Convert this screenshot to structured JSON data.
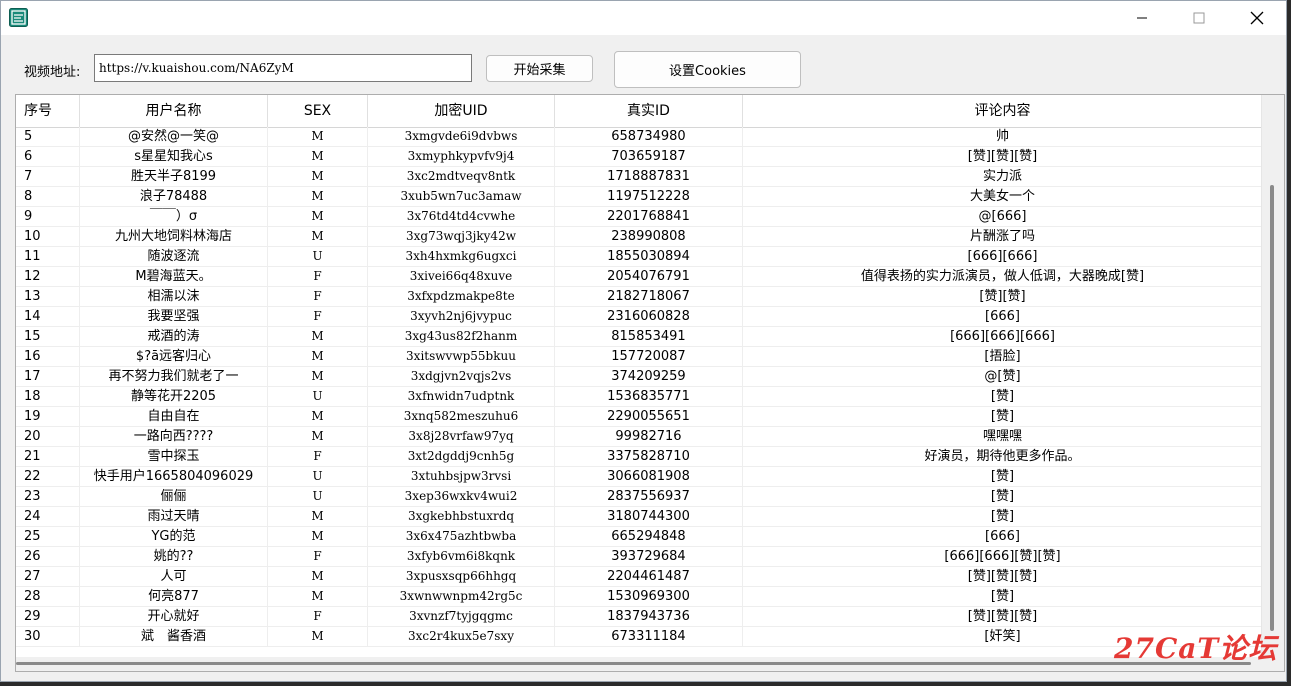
{
  "toolbar": {
    "url_label": "视频地址:",
    "url_value": "https://v.kuaishou.com/NA6ZyM",
    "start_button": "开始采集",
    "cookies_button": "设置Cookies"
  },
  "columns": [
    "序号",
    "用户名称",
    "SEX",
    "加密UID",
    "真实ID",
    "评论内容"
  ],
  "rows": [
    [
      "5",
      "@安然@一笑@",
      "M",
      "3xmgvde6i9dvbws",
      "658734980",
      "帅"
    ],
    [
      "6",
      "s星星知我心s",
      "M",
      "3xmyphkypvfv9j4",
      "703659187",
      "[赞][赞][赞]"
    ],
    [
      "7",
      "胜天半子8199",
      "M",
      "3xc2mdtveqv8ntk",
      "1718887831",
      "实力派"
    ],
    [
      "8",
      "浪子78488",
      "M",
      "3xub5wn7uc3amaw",
      "1197512228",
      "大美女一个"
    ],
    [
      "9",
      "￣￣）σ",
      "M",
      "3x76td4td4cvwhe",
      "2201768841",
      "@[666]"
    ],
    [
      "10",
      "九州大地饲料林海店",
      "M",
      "3xg73wqj3jky42w",
      "238990808",
      "片酬涨了吗"
    ],
    [
      "11",
      "随波逐流",
      "U",
      "3xh4hxmkg6ugxci",
      "1855030894",
      "[666][666]"
    ],
    [
      "12",
      "M碧海蓝天。",
      "F",
      "3xivei66q48xuve",
      "2054076791",
      "值得表扬的实力派演员，做人低调，大器晚成[赞]"
    ],
    [
      "13",
      "相濡以沫",
      "F",
      "3xfxpdzmakpe8te",
      "2182718067",
      "[赞][赞]"
    ],
    [
      "14",
      "我要坚强",
      "F",
      "3xyvh2nj6jvypuc",
      "2316060828",
      "[666]"
    ],
    [
      "15",
      "戒酒的涛",
      "M",
      "3xg43us82f2hanm",
      "815853491",
      "[666][666][666]"
    ],
    [
      "16",
      "$?ā远客归心",
      "M",
      "3xitswvwp55bkuu",
      "157720087",
      "[捂脸]"
    ],
    [
      "17",
      "再不努力我们就老了一",
      "M",
      "3xdgjvn2vqjs2vs",
      "374209259",
      "@[赞]"
    ],
    [
      "18",
      "静等花开2205",
      "U",
      "3xfnwidn7udptnk",
      "1536835771",
      "[赞]"
    ],
    [
      "19",
      "自由自在",
      "M",
      "3xnq582meszuhu6",
      "2290055651",
      "[赞]"
    ],
    [
      "20",
      "一路向西????",
      "M",
      "3x8j28vrfaw97yq",
      "99982716",
      "嘿嘿嘿"
    ],
    [
      "21",
      "雪中探玉",
      "F",
      "3xt2dgddj9cnh5g",
      "3375828710",
      "好演员，期待他更多作品。"
    ],
    [
      "22",
      "快手用户1665804096029",
      "U",
      "3xtuhbsjpw3rvsi",
      "3066081908",
      "[赞]"
    ],
    [
      "23",
      "俪俪",
      "U",
      "3xep36wxkv4wui2",
      "2837556937",
      "[赞]"
    ],
    [
      "24",
      "雨过天晴",
      "M",
      "3xgkebhbstuxrdq",
      "3180744300",
      "[赞]"
    ],
    [
      "25",
      "YG的范",
      "M",
      "3x6x475azhtbwba",
      "665294848",
      "[666]"
    ],
    [
      "26",
      "姚的??",
      "F",
      "3xfyb6vm6i8kqnk",
      "393729684",
      "[666][666][赞][赞]"
    ],
    [
      "27",
      "人可",
      "M",
      "3xpusxsqp66hhgq",
      "2204461487",
      "[赞][赞][赞]"
    ],
    [
      "28",
      "何亮877",
      "M",
      "3xwnwwnpm42rg5c",
      "1530969300",
      "[赞]"
    ],
    [
      "29",
      "开心就好",
      "F",
      "3xvnzf7tyjgqgmc",
      "1837943736",
      "[赞][赞][赞]"
    ],
    [
      "30",
      "斌　酱香酒",
      "M",
      "3xc2r4kux5e7sxy",
      "673311184",
      "[奸笑]"
    ]
  ],
  "watermark": "27CaT论坛",
  "icons": {
    "app": "app-logo-icon",
    "minimize": "minimize-icon",
    "maximize": "maximize-icon",
    "close": "close-icon"
  },
  "colors": {
    "watermark": "#e53935",
    "app_icon": "#1a8a7a"
  }
}
